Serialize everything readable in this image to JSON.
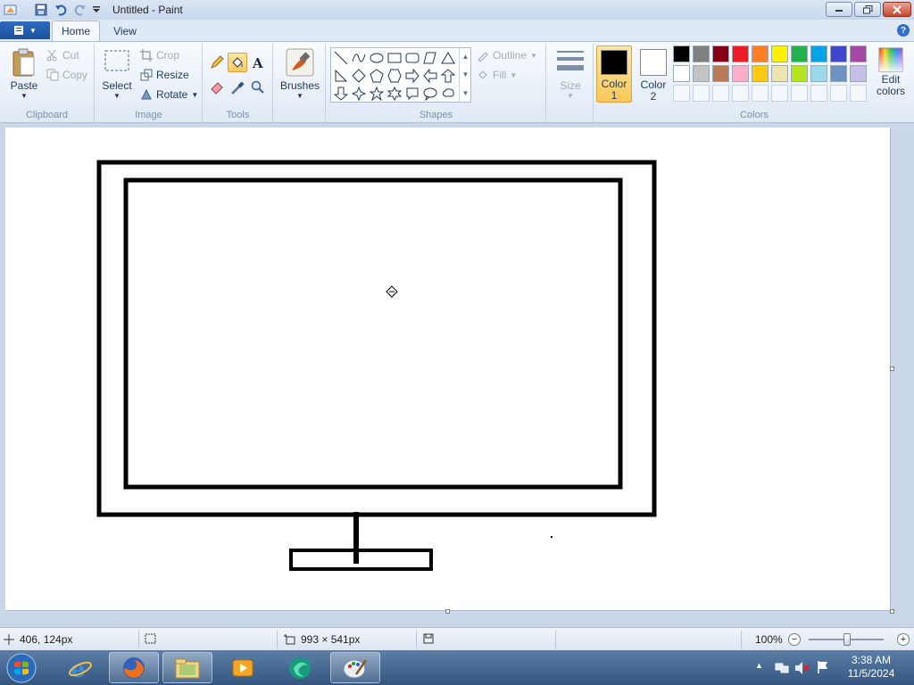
{
  "window": {
    "title": "Untitled - Paint",
    "minimize_icon": "minimize-icon",
    "maximize_icon": "restore-icon",
    "close_icon": "close-icon"
  },
  "quick_access": [
    "save-icon",
    "undo-icon",
    "redo-icon",
    "customize-dropdown-icon"
  ],
  "tabs": {
    "home": "Home",
    "view": "View"
  },
  "ribbon": {
    "clipboard": {
      "label": "Clipboard",
      "paste": "Paste",
      "cut": "Cut",
      "copy": "Copy"
    },
    "image": {
      "label": "Image",
      "select": "Select",
      "crop": "Crop",
      "resize": "Resize",
      "rotate": "Rotate"
    },
    "tools": {
      "label": "Tools",
      "items": [
        "pencil-icon",
        "fill-bucket-icon",
        "text-icon",
        "eraser-icon",
        "color-picker-icon",
        "magnifier-icon"
      ],
      "active": "fill-bucket-icon"
    },
    "brushes": {
      "label": "Brushes"
    },
    "shapes": {
      "label": "Shapes",
      "outline": "Outline",
      "fill": "Fill"
    },
    "size": {
      "label": "Size"
    },
    "colors": {
      "label": "Colors",
      "color1_label": "Color",
      "color1_num": "1",
      "color1_value": "#000000",
      "color2_label": "Color",
      "color2_num": "2",
      "color2_value": "#ffffff",
      "edit": "Edit colors",
      "palette_row1": [
        "#000000",
        "#7f7f7f",
        "#880015",
        "#ed1c24",
        "#ff7f27",
        "#fff200",
        "#22b14c",
        "#00a2e8",
        "#3f48cc",
        "#a349a4"
      ],
      "palette_row2": [
        "#ffffff",
        "#c3c3c3",
        "#b97a57",
        "#ffaec9",
        "#ffc90e",
        "#efe4b0",
        "#b5e61d",
        "#99d9ea",
        "#7092be",
        "#c8bfe7"
      ]
    }
  },
  "status": {
    "cursor_pos": "406, 124px",
    "canvas_size": "993 × 541px",
    "zoom": "100%"
  },
  "taskbar": {
    "apps": [
      "internet-explorer-icon",
      "firefox-icon",
      "file-explorer-icon",
      "media-player-icon",
      "app-icon",
      "paint-icon"
    ],
    "time": "3:38 AM",
    "date": "11/5/2024"
  }
}
